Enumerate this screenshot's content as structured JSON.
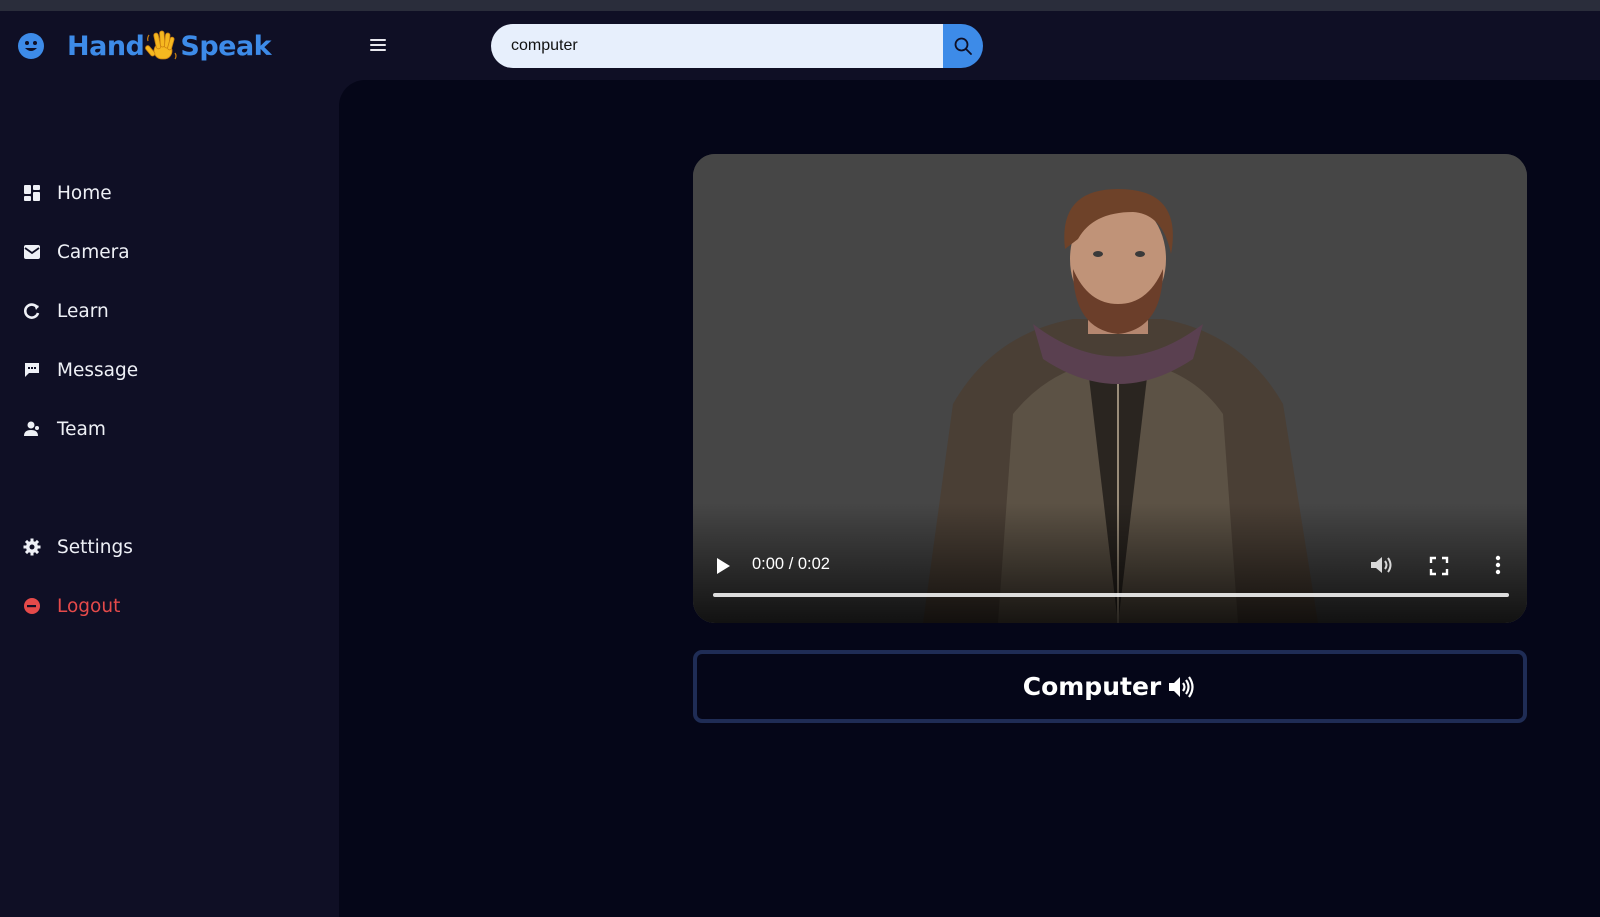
{
  "brand": {
    "name_left": "Hand",
    "name_right": "Speak"
  },
  "search": {
    "value": "computer"
  },
  "sidebar": {
    "items": [
      {
        "label": "Home",
        "icon": "grid-icon"
      },
      {
        "label": "Camera",
        "icon": "envelope-icon"
      },
      {
        "label": "Learn",
        "icon": "refresh-icon"
      },
      {
        "label": "Message",
        "icon": "chat-icon"
      },
      {
        "label": "Team",
        "icon": "user-icon"
      }
    ],
    "settings": {
      "label": "Settings",
      "icon": "gear-icon"
    },
    "logout": {
      "label": "Logout",
      "icon": "logout-icon"
    }
  },
  "video": {
    "time": "0:00 / 0:02",
    "progress": 0
  },
  "word": {
    "text": "Computer"
  },
  "colors": {
    "accent": "#3d8be8",
    "logout": "#e54a4a",
    "sidebar_bg": "#0f0f25",
    "main_bg": "#050618",
    "card_border": "#1f2c55"
  }
}
